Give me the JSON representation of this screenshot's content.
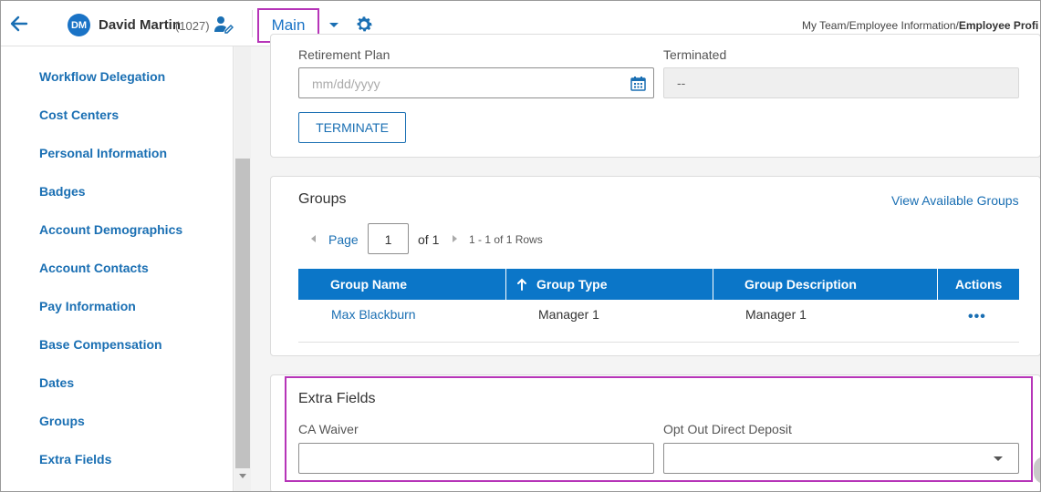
{
  "header": {
    "user_initials": "DM",
    "user_name": "David Martin",
    "user_id": "(1027)",
    "main_tab_label": "Main",
    "breadcrumb_prefix": "My Team/Employee Information/",
    "breadcrumb_current": "Employee Profi"
  },
  "sidebar": {
    "items": [
      {
        "label": "Workflow Delegation"
      },
      {
        "label": "Cost Centers"
      },
      {
        "label": "Personal Information"
      },
      {
        "label": "Badges"
      },
      {
        "label": "Account Demographics"
      },
      {
        "label": "Account Contacts"
      },
      {
        "label": "Pay Information"
      },
      {
        "label": "Base Compensation"
      },
      {
        "label": "Dates"
      },
      {
        "label": "Groups"
      },
      {
        "label": "Extra Fields"
      }
    ]
  },
  "dates_card": {
    "retirement_label": "Retirement Plan",
    "retirement_placeholder": "mm/dd/yyyy",
    "terminated_label": "Terminated",
    "terminated_value": "--",
    "terminate_button": "TERMINATE"
  },
  "groups_card": {
    "title": "Groups",
    "view_available": "View Available Groups",
    "pager": {
      "page_label": "Page",
      "page_value": "1",
      "of_label": "of 1",
      "rows_label": "1 - 1 of 1 Rows"
    },
    "columns": [
      "Group Name",
      "Group Type",
      "Group Description",
      "Actions"
    ],
    "rows": [
      {
        "name": "Max Blackburn",
        "type": "Manager 1",
        "description": "Manager 1",
        "actions": "•••"
      }
    ]
  },
  "extra_fields_card": {
    "title": "Extra Fields",
    "ca_waiver_label": "CA Waiver",
    "opt_out_label": "Opt Out Direct Deposit"
  },
  "colors": {
    "accent": "#1a6fb3",
    "grid_header": "#0b76c8",
    "highlight": "#b634b8"
  },
  "icons": {
    "back": "back-arrow-icon",
    "user_edit": "user-edit-icon",
    "caret": "caret-down-icon",
    "settings": "gear-icon",
    "calendar": "calendar-icon",
    "sort": "sort-up-icon",
    "more": "more-dots-icon"
  }
}
